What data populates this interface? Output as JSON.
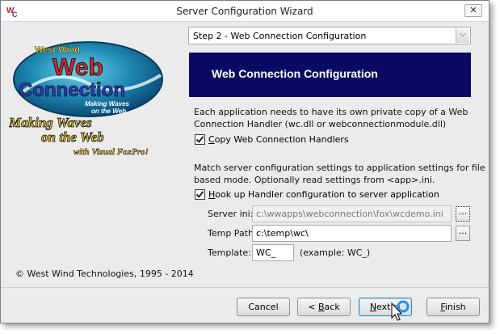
{
  "window": {
    "title": "Server Configuration Wizard",
    "close_label": "✕"
  },
  "left_panel": {
    "logo_top": "West Wind",
    "logo_main1": "Web",
    "logo_main2": "Connection",
    "logo_tag1": "Making Waves",
    "logo_tag2": "on the Web",
    "slogan1": "Making Waves",
    "slogan2": "on the Web",
    "slogan3": "with Visual FoxPro!",
    "copyright": "© West Wind Technologies, 1995 - 2014"
  },
  "step_select": {
    "value": "Step 2 - Web Connection Configuration"
  },
  "banner": {
    "title": "Web Connection Configuration"
  },
  "section1": {
    "text_line1": "Each application needs to have its own private copy of a Web",
    "text_line2": "Connection Handler (wc.dll or webconnectionmodule.dll)",
    "checkbox_label": "Copy Web Connection Handlers",
    "checkbox_accel": "C",
    "checkbox_rest": "opy Web Connection Handlers",
    "checked": true
  },
  "section2": {
    "text_line1": "Match server configuration settings to application settings for file",
    "text_line2": "based mode. Optionally read settings from <app>.ini.",
    "checkbox_accel": "H",
    "checkbox_rest": "ook up Handler configuration to server application",
    "checked": true
  },
  "fields": {
    "server_ini_label": "Server ini:",
    "server_ini_value": "c:\\wwapps\\webconnection\\fox\\wcdemo.ini",
    "temp_path_label": "Temp Path:",
    "temp_path_value": "c:\\temp\\wc\\",
    "template_label": "Template:",
    "template_value": "WC_",
    "template_hint": "(example: WC_)",
    "browse_label": "..."
  },
  "buttons": {
    "cancel": "Cancel",
    "back_prefix": "< ",
    "back_accel": "B",
    "back_rest": "ack",
    "next_accel": "N",
    "next_rest": "ext >",
    "finish_accel": "F",
    "finish_rest": "inish"
  },
  "colors": {
    "banner_bg": "#0a0a66",
    "window_bg": "#ebebeb"
  }
}
